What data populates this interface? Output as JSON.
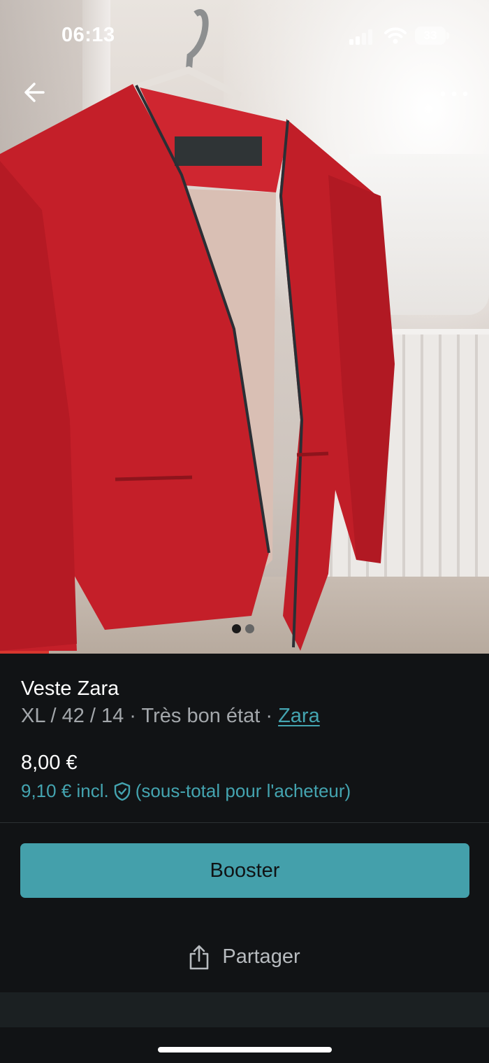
{
  "status_bar": {
    "time": "06:13",
    "battery": "33"
  },
  "nav": {
    "back_icon": "arrow-left-icon",
    "more_icon": "more-horizontal-icon"
  },
  "gallery": {
    "image_count": 2,
    "active_index": 0
  },
  "item": {
    "title": "Veste Zara",
    "meta_prefix": "XL / 42 / 14 · Très bon état · ",
    "brand": "Zara",
    "price": "8,00 €",
    "buyer_price_prefix": "9,10 € incl.",
    "buyer_price_suffix": "(sous-total pour l'acheteur)",
    "protection_icon": "shield-check-icon"
  },
  "actions": {
    "booster_label": "Booster",
    "share_label": "Partager",
    "share_icon": "share-icon"
  },
  "colors": {
    "accent": "#44a0ab",
    "link": "#44a4b0",
    "background": "#111315",
    "jacket": "#c8232b"
  }
}
